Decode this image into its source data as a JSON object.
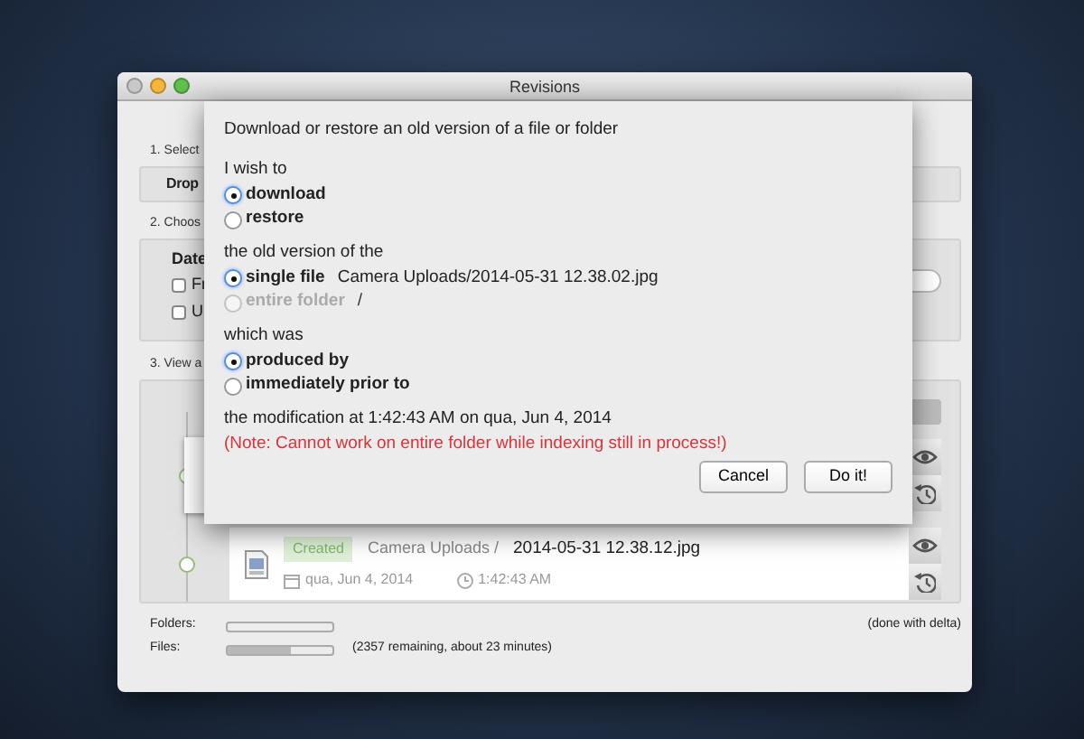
{
  "window": {
    "title": "Revisions"
  },
  "background": {
    "step_1": {
      "label": "1. Select",
      "source": "Drop"
    },
    "step_2": {
      "label": "2. Choos",
      "date_label": "Date",
      "checkboxes": [
        {
          "label": "Fr",
          "checked": false
        },
        {
          "label": "U",
          "checked": false
        }
      ]
    },
    "step_3": {
      "label": "3. View a",
      "entries": [
        {
          "kind": "covered"
        },
        {
          "kind": "shown",
          "event": "Created",
          "folder": "Camera Uploads /",
          "filename": "2014-05-31 12.38.12.jpg",
          "date": "qua, Jun 4, 2014",
          "time": "1:42:43 AM"
        }
      ]
    }
  },
  "status": {
    "folders": {
      "label": "Folders:",
      "level": 0,
      "note": "(done with delta)"
    },
    "files": {
      "label": "Files:",
      "level": 0.6,
      "note": "(2357 remaining, about 23 minutes)"
    }
  },
  "dialog": {
    "title": "Download or restore an old version of a file or folder",
    "groups": [
      {
        "label": "I wish to",
        "options": [
          {
            "label": "download",
            "selected": true,
            "disabled": false
          },
          {
            "label": "restore",
            "selected": false,
            "disabled": false
          }
        ]
      },
      {
        "label": "the old version of the",
        "options": [
          {
            "label": "single file",
            "detail": "Camera Uploads/2014-05-31 12.38.02.jpg",
            "selected": true,
            "disabled": false
          },
          {
            "label": "entire folder",
            "detail": "/",
            "selected": false,
            "disabled": true
          }
        ]
      },
      {
        "label": "which was",
        "options": [
          {
            "label": "produced by",
            "selected": true,
            "disabled": false
          },
          {
            "label": "immediately prior to",
            "selected": false,
            "disabled": false
          }
        ]
      }
    ],
    "modification": "the modification at 1:42:43 AM on qua, Jun 4, 2014",
    "note": "(Note: Cannot work on entire folder while indexing still in process!)",
    "buttons": [
      "Cancel",
      "Do it!"
    ]
  }
}
